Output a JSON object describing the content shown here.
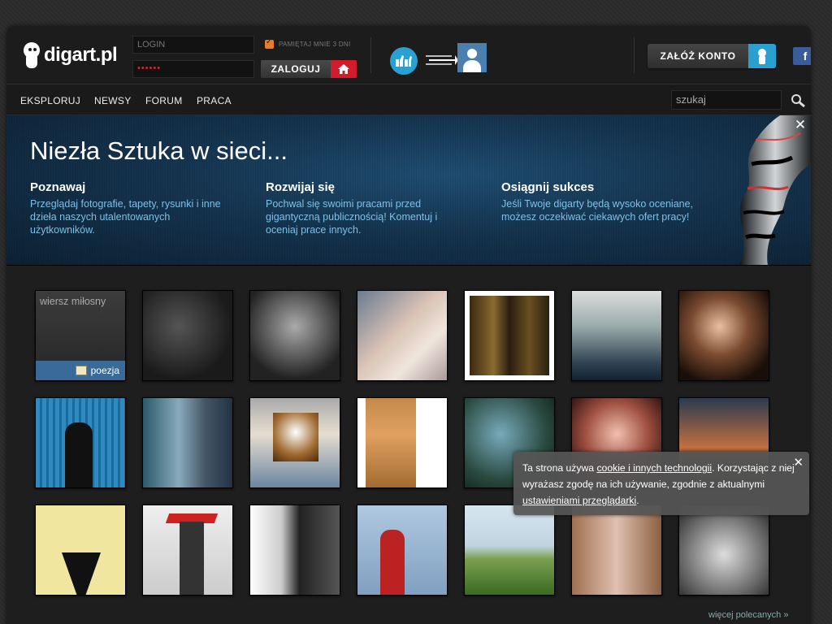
{
  "logo": {
    "text": "digart.pl"
  },
  "login": {
    "login_placeholder": "LOGIN",
    "password_value": "••••••",
    "remember_label": "PAMIĘTAJ MNIE 3 DNI",
    "login_button": "ZALOGUJ"
  },
  "header": {
    "register_button": "ZAŁÓŻ KONTO",
    "facebook_label": "f"
  },
  "nav": {
    "items": [
      "EKSPLORUJ",
      "NEWSY",
      "FORUM",
      "PRACA"
    ],
    "search_value": "szukaj"
  },
  "banner": {
    "title": "Niezła Sztuka w sieci...",
    "features": [
      {
        "title": "Poznawaj",
        "desc": "Przeglądaj fotografie, tapety, rysunki i inne dzieła naszych utalentowanych użytkowników."
      },
      {
        "title": "Rozwijaj się",
        "desc": "Pochwal się swoimi pracami przed gigantyczną publicznością! Komentuj i oceniaj prace innych."
      },
      {
        "title": "Osiągnij sukces",
        "desc": "Jeśli Twoje digarty będą wysoko oceniane, możesz oczekiwać ciekawych ofert pracy!"
      }
    ],
    "close_label": "✕"
  },
  "gallery": {
    "text_tile": {
      "title": "wiersz miłosny",
      "category": "poezja"
    },
    "more_link": "więcej polecanych »"
  },
  "cookie": {
    "t1": "Ta strona używa ",
    "link1": "cookie i innych technologii",
    "t2": ". Korzystając z niej wyrażasz zgodę na ich używanie, zgodnie z aktualnymi ",
    "link2": "ustawieniami przeglądarki",
    "t3": ".",
    "close_label": "✕"
  },
  "colors": {
    "accent_red": "#d21c2c",
    "accent_blue": "#2aa0d0",
    "banner_text": "#7ec0e6"
  }
}
